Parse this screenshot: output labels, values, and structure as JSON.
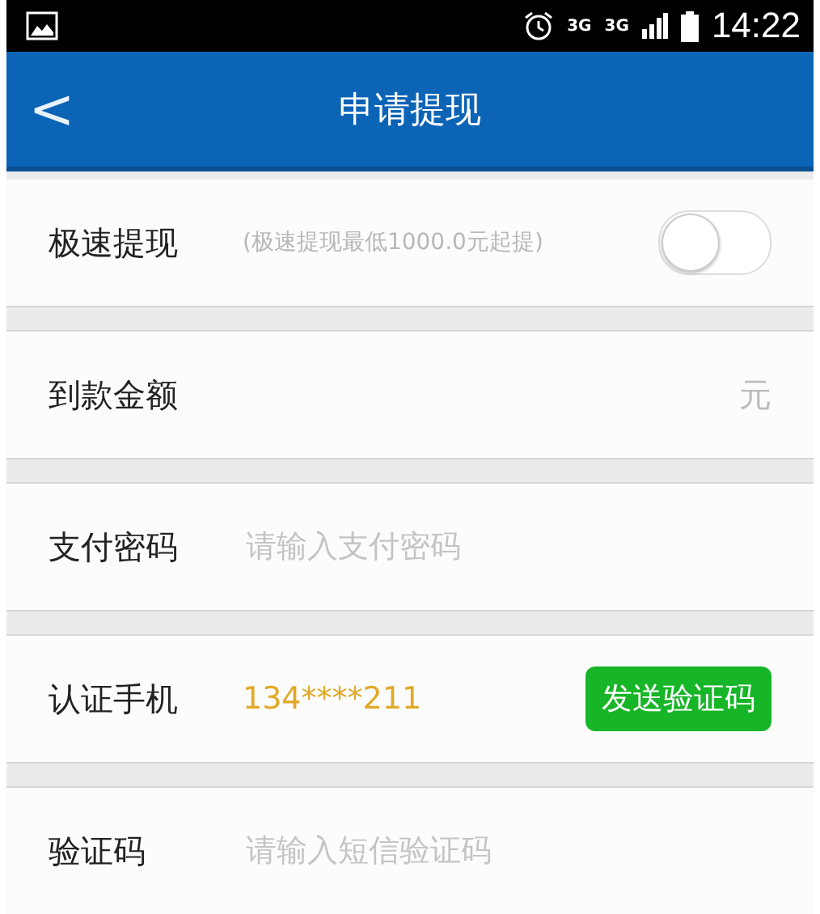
{
  "status_bar": {
    "time": "14:22",
    "network_1": "3G",
    "network_2": "3G"
  },
  "app_bar": {
    "back": "<",
    "title": "申请提现"
  },
  "rows": [
    {
      "kind": "toggle",
      "label": "极速提现",
      "hint": "(极速提现最低1000.0元起提)",
      "on": false
    },
    {
      "kind": "amount",
      "label": "到款金额",
      "unit": "元"
    },
    {
      "kind": "field",
      "label": "支付密码",
      "placeholder": "请输入支付密码"
    },
    {
      "kind": "phone",
      "label": "认证手机",
      "value": "134****211",
      "button": "发送验证码"
    },
    {
      "kind": "field",
      "label": "验证码",
      "placeholder": "请输入短信验证码"
    }
  ]
}
